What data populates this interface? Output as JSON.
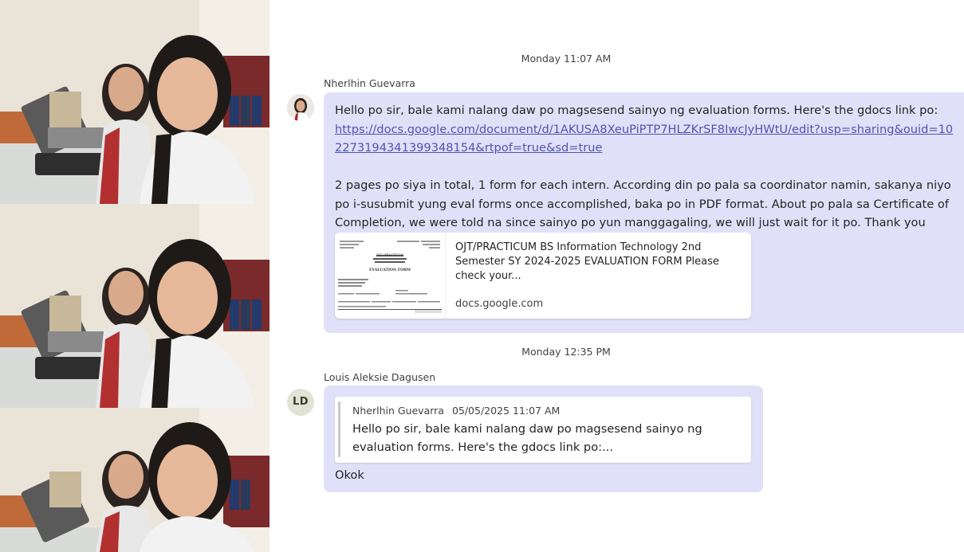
{
  "photos": {
    "count": 3,
    "description_icon": "selfie-photo"
  },
  "chat": {
    "messages": [
      {
        "timestamp": "Monday 11:07 AM",
        "sender": "Nherlhin Guevarra",
        "avatar_icon": "profile-photo-icon",
        "line1": "Hello po sir, bale kami nalang daw po magsesend sainyo ng evaluation forms. Here's the gdocs link po:",
        "link": "https://docs.google.com/document/d/1AKUSA8XeuPiPTP7HLZKrSF8IwcJyHWtU/edit?usp=sharing&ouid=102273194341399348154&rtpof=true&sd=true",
        "paragraph2": "2 pages po siya in total, 1 form for each intern. According din po pala sa coordinator namin, sakanya niyo po i-susubmit yung eval forms once accomplished, baka po in PDF format. About po pala sa Certificate of Completion, we were told na since sainyo po yun manggagaling, we will just wait for it po. Thank you again, sir!",
        "preview": {
          "title": "OJT/PRACTICUM BS Information Technology 2nd Semester SY 2024-2025 EVALUATION FORM Please check your...",
          "domain": "docs.google.com",
          "thumb_heading": "EVALUATION FORM",
          "thumb_sub": "OJT / PRACTICUM"
        }
      },
      {
        "timestamp": "Monday 12:35 PM",
        "sender": "Louis Aleksie Dagusen",
        "avatar_initials": "LD",
        "quote": {
          "author": "Nherlhin Guevarra",
          "time": "05/05/2025 11:07 AM",
          "text": "Hello po sir, bale kami nalang daw po magsesend sainyo ng evaluation forms. Here's the gdocs link po:..."
        },
        "reply": "Okok"
      }
    ]
  },
  "colors": {
    "bubble": "#e0e1f9",
    "link": "#4f52b2",
    "background": "#ffffff"
  }
}
